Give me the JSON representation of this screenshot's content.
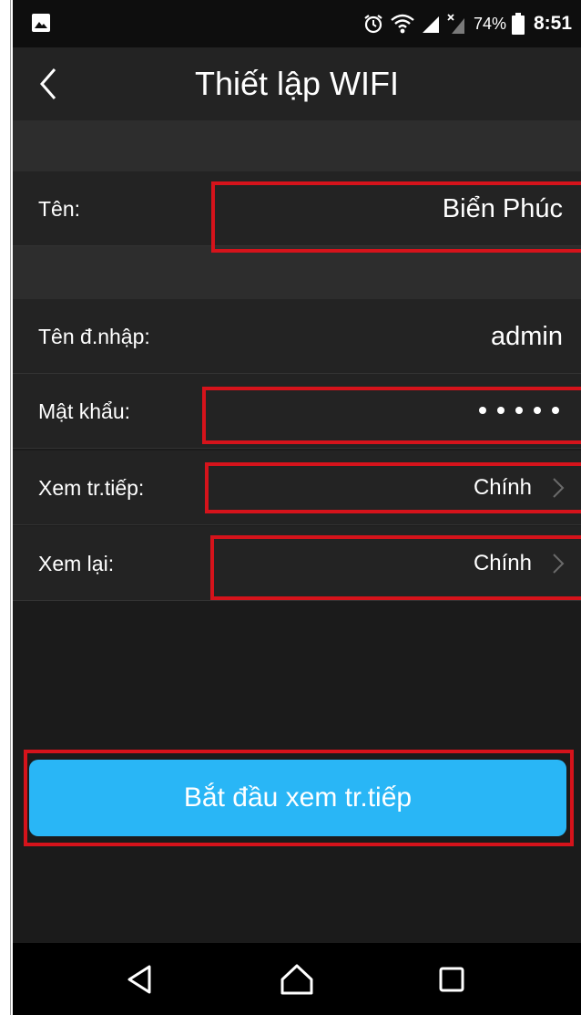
{
  "status_bar": {
    "battery_percent": "74%",
    "time": "8:51"
  },
  "header": {
    "title": "Thiết lập WIFI"
  },
  "form": {
    "name_label": "Tên:",
    "name_value": "Biển Phúc",
    "username_label": "Tên đ.nhập:",
    "username_value": "admin",
    "password_label": "Mật khẩu:",
    "password_mask": "•••••",
    "live_view_label": "Xem tr.tiếp:",
    "live_view_value": "Chính",
    "playback_label": "Xem lại:",
    "playback_value": "Chính"
  },
  "actions": {
    "start_button_label": "Bắt đầu xem tr.tiếp"
  },
  "colors": {
    "highlight": "#d5131b",
    "primary_button": "#29b6f6",
    "background": "#1b1b1b"
  },
  "icons": {
    "status_left": "gallery-icon",
    "status_right": [
      "alarm-icon",
      "wifi-icon",
      "signal-icon",
      "signal-nodata-icon",
      "battery-icon"
    ],
    "header": "back-chevron-icon",
    "rows": "chevron-right-icon",
    "nav": [
      "nav-back-icon",
      "nav-home-icon",
      "nav-recents-icon"
    ]
  }
}
